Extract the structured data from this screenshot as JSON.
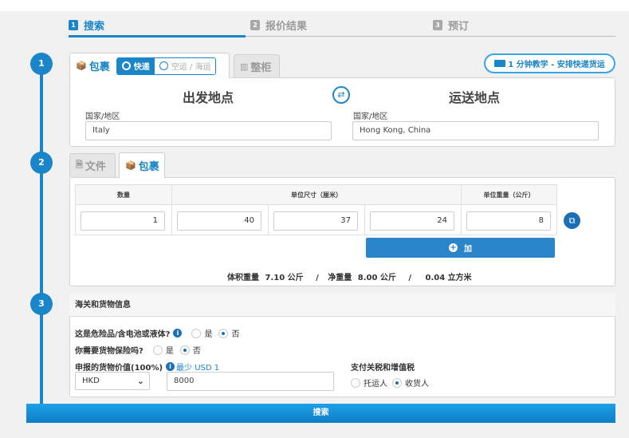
{
  "steps": [
    {
      "num": "1",
      "label": "搜索"
    },
    {
      "num": "2",
      "label": "报价结果"
    },
    {
      "num": "3",
      "label": "预订"
    }
  ],
  "timeline": [
    "1",
    "2",
    "3"
  ],
  "section1": {
    "tab_parcel": "包裹",
    "tab_container": "整柜",
    "mode_express": "快递",
    "mode_air_sea": "空运 / 海运",
    "tutorial": "1 分钟教学 - 安排快递货运",
    "origin_title": "出发地点",
    "destination_title": "运送地点",
    "origin_label": "国家/地区",
    "origin_value": "Italy",
    "destination_label": "国家/地区",
    "destination_value": "Hong Kong, China"
  },
  "section2": {
    "tab_documents": "文件",
    "tab_parcel": "包裹",
    "headers": {
      "qty": "数量",
      "dims": "单位尺寸（厘米）",
      "weight": "单位重量（公斤）"
    },
    "row": {
      "qty": "1",
      "length": "40",
      "width": "37",
      "height": "24",
      "weight": "8"
    },
    "add_label": "加",
    "summary": {
      "volumetric_label": "体积重量",
      "volumetric_value": "7.10 公斤",
      "sep1": "/",
      "net_label": "净重量",
      "net_value": "8.00 公斤",
      "sep2": "/",
      "volume": "0.04 立方米"
    }
  },
  "section3": {
    "title": "海关和货物信息",
    "dangerous_q": "这是危险品/含电池或液体?",
    "insurance_q": "你需要货物保险吗?",
    "yes": "是",
    "no": "否",
    "declared_label": "申报的货物价值(100%)",
    "declared_min": "最少 USD 1",
    "currency": "HKD",
    "declared_value": "8000",
    "duties_label": "支付关税和增值税",
    "shipper": "托运人",
    "consignee": "收货人"
  },
  "search_label": "搜索",
  "colors": {
    "accent": "#1a85c8",
    "button": "#2b86c9",
    "page_bg": "#f1f1f1"
  }
}
